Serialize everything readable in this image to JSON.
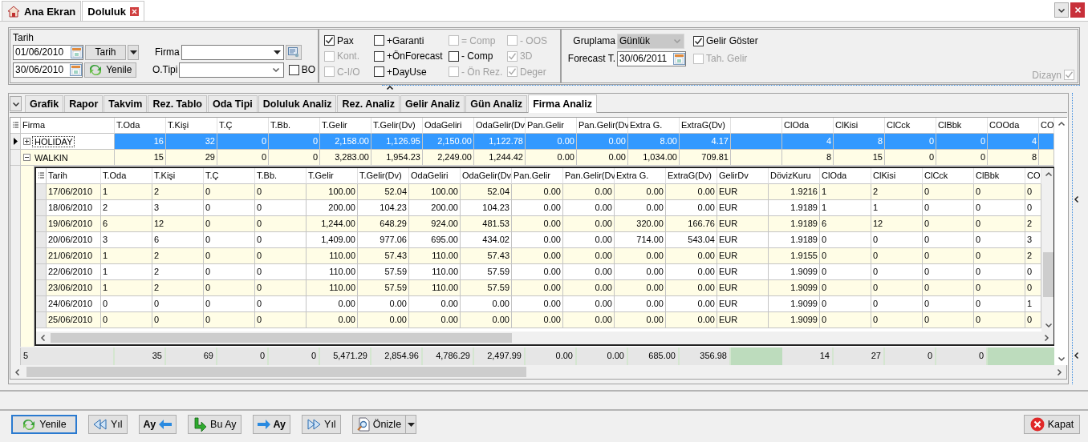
{
  "top_tabs": [
    {
      "label": "Ana Ekran",
      "selected": false,
      "closable": false
    },
    {
      "label": "Doluluk",
      "selected": true,
      "closable": true
    }
  ],
  "filters": {
    "date_label": "Tarih",
    "start_date": "01/06/2010",
    "end_date": "30/06/2010",
    "date_button": "Tarih",
    "refresh_button": "Yenile",
    "firma_label": "Firma",
    "otipi_label": "O.Tipi",
    "bo": {
      "label": "BO",
      "checked": false,
      "disabled": false
    }
  },
  "options": [
    {
      "label": "Pax",
      "checked": true,
      "disabled": false
    },
    {
      "label": "+Garanti",
      "checked": false,
      "disabled": false
    },
    {
      "label": "= Comp",
      "checked": false,
      "disabled": true
    },
    {
      "label": "- OOS",
      "checked": false,
      "disabled": true
    },
    {
      "label": "Kont.",
      "checked": false,
      "disabled": true
    },
    {
      "label": "+ÖnForecast",
      "checked": false,
      "disabled": false
    },
    {
      "label": "- Comp",
      "checked": false,
      "disabled": false
    },
    {
      "label": "3D",
      "checked": true,
      "disabled": true
    },
    {
      "label": "C-I/O",
      "checked": false,
      "disabled": true
    },
    {
      "label": "+DayUse",
      "checked": false,
      "disabled": false
    },
    {
      "label": "- Ön Rez.",
      "checked": false,
      "disabled": true
    },
    {
      "label": "Deger",
      "checked": true,
      "disabled": true
    }
  ],
  "grouping": {
    "label": "Gruplama",
    "value": "Günlük",
    "disabled": true
  },
  "forecast": {
    "label": "Forecast T.",
    "value": "30/06/2011"
  },
  "show_income": {
    "label": "Gelir Göster",
    "checked": true,
    "disabled": false
  },
  "collected_income": {
    "label": "Tah. Gelir",
    "checked": false,
    "disabled": true
  },
  "design": {
    "label": "Dizayn",
    "checked": true,
    "disabled": true
  },
  "view_tabs": [
    {
      "label": "Grafik",
      "selected": false
    },
    {
      "label": "Rapor",
      "selected": false
    },
    {
      "label": "Takvim",
      "selected": false
    },
    {
      "label": "Rez. Tablo",
      "selected": false
    },
    {
      "label": "Oda Tipi",
      "selected": false
    },
    {
      "label": "Doluluk Analiz",
      "selected": false
    },
    {
      "label": "Rez. Analiz",
      "selected": false
    },
    {
      "label": "Gelir Analiz",
      "selected": false
    },
    {
      "label": "Gün Analiz",
      "selected": false
    },
    {
      "label": "Firma Analiz",
      "selected": true
    }
  ],
  "master_grid": {
    "columns": [
      "Firma",
      "T.Oda",
      "T.Kişi",
      "T.Ç",
      "T.Bb.",
      "T.Gelir",
      "T.Gelir(Dv)",
      "OdaGeliri",
      "OdaGelir(Dv",
      "Pan.Gelir",
      "Pan.Gelir(Dv",
      "Extra G.",
      "ExtraG(Dv)",
      "",
      "ClOda",
      "ClKisi",
      "ClCck",
      "ClBbk",
      "COOda",
      "CO"
    ],
    "rows": [
      {
        "selected": true,
        "expanded": false,
        "cells": [
          "HOLIDAY",
          "16",
          "32",
          "0",
          "0",
          "2,158.00",
          "1,126.95",
          "2,150.00",
          "1,122.78",
          "0.00",
          "0.00",
          "8.00",
          "4.17",
          "",
          "4",
          "8",
          "0",
          "0",
          "4",
          ""
        ]
      },
      {
        "selected": false,
        "expanded": true,
        "cells": [
          "WALKIN",
          "15",
          "29",
          "0",
          "0",
          "3,283.00",
          "1,954.23",
          "2,249.00",
          "1,244.42",
          "0.00",
          "0.00",
          "1,034.00",
          "709.81",
          "",
          "8",
          "15",
          "0",
          "0",
          "8",
          ""
        ]
      }
    ],
    "footer": [
      {
        "blank": false,
        "text": "5"
      },
      {
        "blank": false,
        "text": "35"
      },
      {
        "blank": false,
        "text": "69"
      },
      {
        "blank": false,
        "text": "0"
      },
      {
        "blank": false,
        "text": "0"
      },
      {
        "blank": false,
        "text": "5,471.29"
      },
      {
        "blank": false,
        "text": "2,854.96"
      },
      {
        "blank": false,
        "text": "4,786.29"
      },
      {
        "blank": false,
        "text": "2,497.99"
      },
      {
        "blank": false,
        "text": "0.00"
      },
      {
        "blank": false,
        "text": "0.00"
      },
      {
        "blank": false,
        "text": "685.00"
      },
      {
        "blank": false,
        "text": "356.98"
      },
      {
        "blank": true
      },
      {
        "blank": false,
        "text": "14"
      },
      {
        "blank": false,
        "text": "27"
      },
      {
        "blank": false,
        "text": "0"
      },
      {
        "blank": false,
        "text": "0"
      },
      {
        "blank": true
      },
      {
        "blank": true
      }
    ]
  },
  "detail_grid": {
    "columns": [
      "Tarih",
      "T.Oda",
      "T.Kişi",
      "T.Ç",
      "T.Bb.",
      "T.Gelir",
      "T.Gelir(Dv)",
      "OdaGeliri",
      "OdaGelir(Dv",
      "Pan.Gelir",
      "Pan.Gelir(Dv",
      "Extra G.",
      "ExtraG(Dv)",
      "GelirDv",
      "DövizKuru",
      "ClOda",
      "ClKisi",
      "ClCck",
      "ClBbk",
      "CO"
    ],
    "rows": [
      [
        "17/06/2010",
        "1",
        "2",
        "0",
        "0",
        "100.00",
        "52.04",
        "100.00",
        "52.04",
        "0.00",
        "0.00",
        "0.00",
        "0.00",
        "EUR",
        "1.9216",
        "1",
        "2",
        "0",
        "0",
        "0"
      ],
      [
        "18/06/2010",
        "2",
        "3",
        "0",
        "0",
        "200.00",
        "104.23",
        "200.00",
        "104.23",
        "0.00",
        "0.00",
        "0.00",
        "0.00",
        "EUR",
        "1.9189",
        "1",
        "1",
        "0",
        "0",
        "0"
      ],
      [
        "19/06/2010",
        "6",
        "12",
        "0",
        "0",
        "1,244.00",
        "648.29",
        "924.00",
        "481.53",
        "0.00",
        "0.00",
        "320.00",
        "166.76",
        "EUR",
        "1.9189",
        "6",
        "12",
        "0",
        "0",
        "2"
      ],
      [
        "20/06/2010",
        "3",
        "6",
        "0",
        "0",
        "1,409.00",
        "977.06",
        "695.00",
        "434.02",
        "0.00",
        "0.00",
        "714.00",
        "543.04",
        "EUR",
        "1.9189",
        "0",
        "0",
        "0",
        "0",
        "3"
      ],
      [
        "21/06/2010",
        "1",
        "2",
        "0",
        "0",
        "110.00",
        "57.43",
        "110.00",
        "57.43",
        "0.00",
        "0.00",
        "0.00",
        "0.00",
        "EUR",
        "1.9155",
        "0",
        "0",
        "0",
        "0",
        "2"
      ],
      [
        "22/06/2010",
        "1",
        "2",
        "0",
        "0",
        "110.00",
        "57.59",
        "110.00",
        "57.59",
        "0.00",
        "0.00",
        "0.00",
        "0.00",
        "EUR",
        "1.9099",
        "0",
        "0",
        "0",
        "0",
        "0"
      ],
      [
        "23/06/2010",
        "1",
        "2",
        "0",
        "0",
        "110.00",
        "57.59",
        "110.00",
        "57.59",
        "0.00",
        "0.00",
        "0.00",
        "0.00",
        "EUR",
        "1.9099",
        "0",
        "0",
        "0",
        "0",
        "0"
      ],
      [
        "24/06/2010",
        "0",
        "0",
        "0",
        "0",
        "0.00",
        "0.00",
        "0.00",
        "0.00",
        "0.00",
        "0.00",
        "0.00",
        "0.00",
        "EUR",
        "1.9099",
        "0",
        "0",
        "0",
        "0",
        "1"
      ],
      [
        "25/06/2010",
        "0",
        "0",
        "0",
        "0",
        "0.00",
        "0.00",
        "0.00",
        "0.00",
        "0.00",
        "0.00",
        "0.00",
        "0.00",
        "EUR",
        "1.9099",
        "0",
        "0",
        "0",
        "0",
        "0"
      ]
    ]
  },
  "bottom_buttons": [
    {
      "label": "Yenile",
      "kind": "refresh",
      "default": true
    },
    {
      "label": "Yıl",
      "kind": "prev-year",
      "default": false
    },
    {
      "label": "Ay",
      "kind": "prev-month",
      "default": false
    },
    {
      "label": "Bu Ay",
      "kind": "this-month",
      "default": false
    },
    {
      "label": "Ay",
      "kind": "next-month",
      "default": false
    },
    {
      "label": "Yıl",
      "kind": "next-year",
      "default": false
    },
    {
      "label": "Önizle",
      "kind": "preview",
      "default": false
    }
  ],
  "close_button": "Kapat"
}
